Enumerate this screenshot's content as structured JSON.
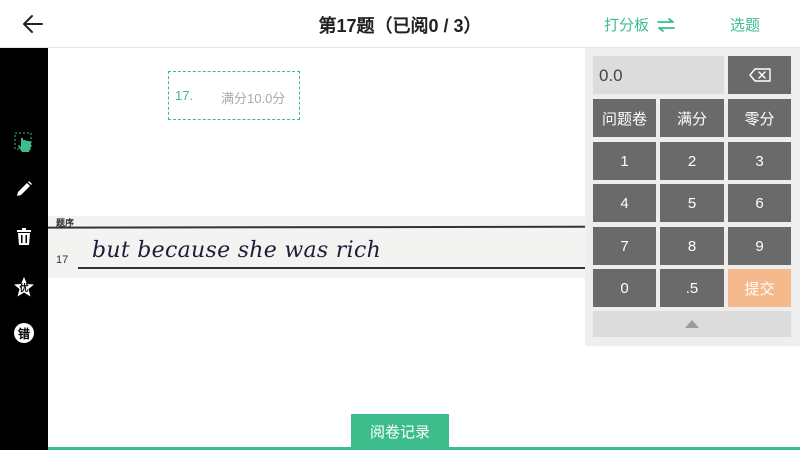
{
  "header": {
    "title": "第17题（已阅0 / 3）",
    "scoreboard_label": "打分板",
    "select_label": "选题"
  },
  "answer": {
    "number": "17.",
    "full_score": "满分10.0分"
  },
  "scan": {
    "top_text": "题序",
    "number": "17",
    "handwriting": "but because she was rich"
  },
  "score_panel": {
    "current_score": "0.0",
    "keys": {
      "question_paper": "问题卷",
      "full_mark": "满分",
      "zero_mark": "零分",
      "k1": "1",
      "k2": "2",
      "k3": "3",
      "k4": "4",
      "k5": "5",
      "k6": "6",
      "k7": "7",
      "k8": "8",
      "k9": "9",
      "k0": "0",
      "half": ".5",
      "submit": "提交"
    }
  },
  "toolbar": {
    "excellent_label": "优",
    "wrong_label": "错"
  },
  "footer": {
    "records_label": "阅卷记录"
  },
  "colors": {
    "accent": "#3dbd8c",
    "submit": "#f6b98c",
    "key_dark": "#6a6a6a",
    "toolbar": "#000000"
  },
  "icons": [
    "back-arrow-icon",
    "swap-icon",
    "hand-pointer-icon",
    "pencil-icon",
    "trash-icon",
    "star-excellent-icon",
    "wrong-mark-icon",
    "backspace-icon",
    "chevron-up-icon"
  ]
}
